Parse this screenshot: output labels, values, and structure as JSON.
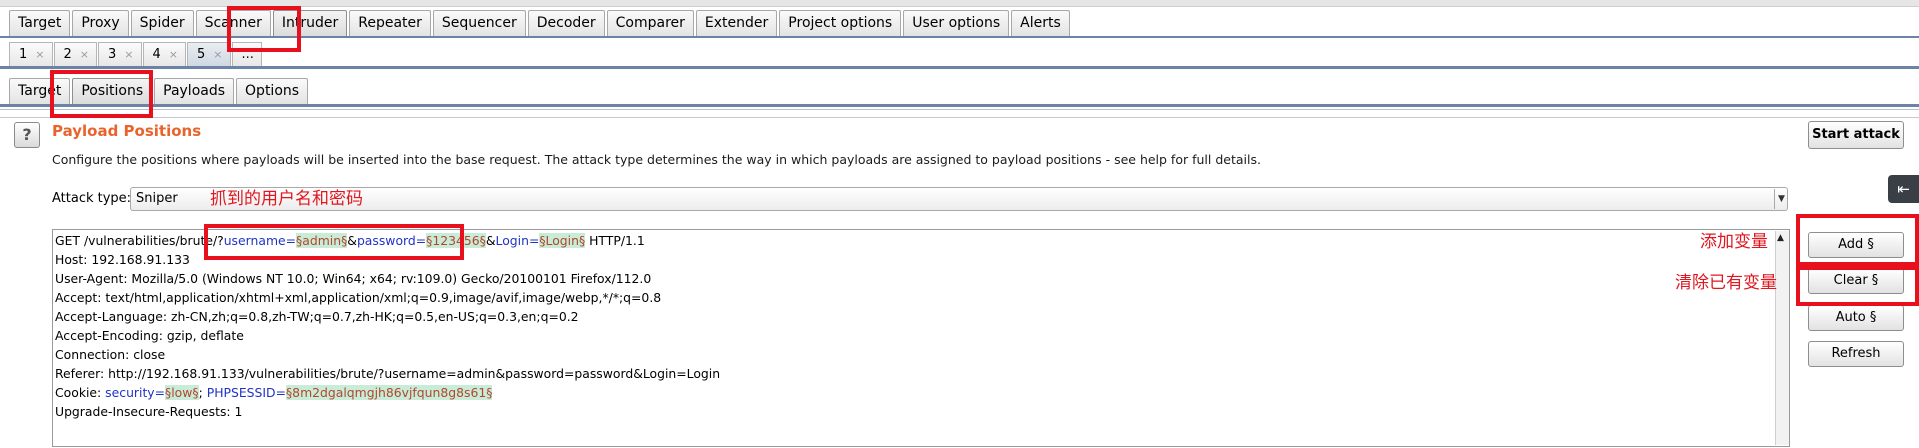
{
  "top_tabs": [
    "Target",
    "Proxy",
    "Spider",
    "Scanner",
    "Intruder",
    "Repeater",
    "Sequencer",
    "Decoder",
    "Comparer",
    "Extender",
    "Project options",
    "User options",
    "Alerts"
  ],
  "attack_tabs": [
    {
      "label": "1",
      "close": "×"
    },
    {
      "label": "2",
      "close": "×"
    },
    {
      "label": "3",
      "close": "×"
    },
    {
      "label": "4",
      "close": "×"
    },
    {
      "label": "5",
      "close": "×"
    },
    {
      "label": "...",
      "close": ""
    }
  ],
  "sub_tabs": [
    "Target",
    "Positions",
    "Payloads",
    "Options"
  ],
  "panel": {
    "help": "?",
    "title": "Payload Positions",
    "description": "Configure the positions where payloads will be inserted into the base request. The attack type determines the way in which payloads are assigned to payload positions - see help for full details.",
    "attack_type_label": "Attack type:",
    "attack_type_value": "Sniper"
  },
  "request": {
    "line1": {
      "prefix": "GET /vulnerabilities/brute/?",
      "p1_name": "username=",
      "p1_value": "§admin§",
      "amp1": "&",
      "p2_name": "password=",
      "p2_value": "§123456§",
      "amp2": "&",
      "p3_name": "Login=",
      "p3_value": "§Login§",
      "suffix": " HTTP/1.1"
    },
    "lines": [
      "Host: 192.168.91.133",
      "User-Agent: Mozilla/5.0 (Windows NT 10.0; Win64; x64; rv:109.0) Gecko/20100101 Firefox/112.0",
      "Accept: text/html,application/xhtml+xml,application/xml;q=0.9,image/avif,image/webp,*/*;q=0.8",
      "Accept-Language: zh-CN,zh;q=0.8,zh-TW;q=0.7,zh-HK;q=0.5,en-US;q=0.3,en;q=0.2",
      "Accept-Encoding: gzip, deflate",
      "Connection: close",
      "Referer: http://192.168.91.133/vulnerabilities/brute/?username=admin&password=password&Login=Login"
    ],
    "cookie": {
      "prefix": "Cookie: ",
      "c1_name": "security=",
      "c1_value": "§low§",
      "sep": "; ",
      "c2_name": "PHPSESSID=",
      "c2_value": "§8m2dgalqmgjh86vjfqun8g8s61§"
    },
    "last_line": "Upgrade-Insecure-Requests: 1"
  },
  "buttons": {
    "start_attack": "Start attack",
    "add": "Add §",
    "clear": "Clear §",
    "auto": "Auto §",
    "refresh": "Refresh",
    "collapse": "⇤"
  },
  "annotations": {
    "captured": "抓到的用户名和密码",
    "add_var": "添加变量",
    "clear_var": "清除已有变量"
  },
  "colors": {
    "accent_title": "#e8642c",
    "annotation_red": "#e8101c",
    "payload_bg": "#c8ecd7",
    "param_name": "#1f33c8",
    "payload_text": "#b2472e"
  }
}
